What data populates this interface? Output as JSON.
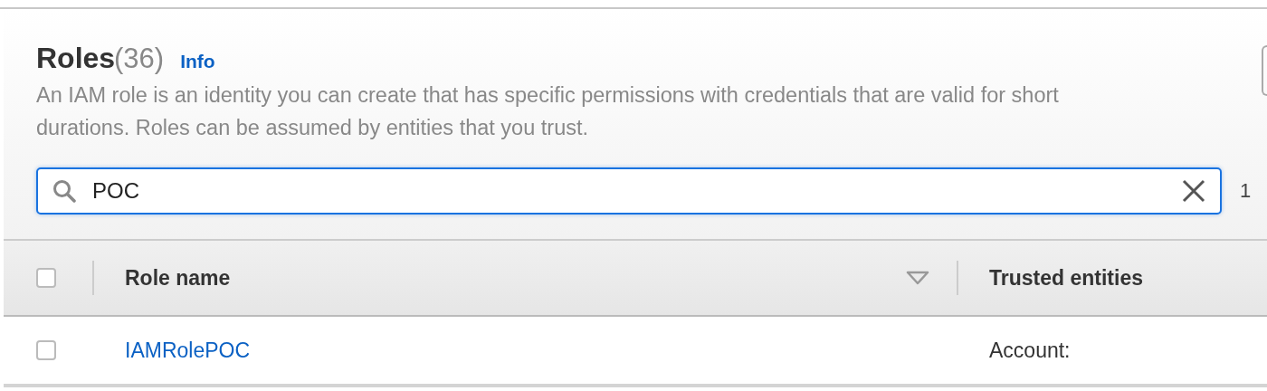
{
  "header": {
    "title": "Roles",
    "count": "(36)",
    "info_link": "Info",
    "description": "An IAM role is an identity you can create that has specific permissions with credentials that are valid for short durations. Roles can be assumed by entities that you trust."
  },
  "search": {
    "value": "POC",
    "results": "1"
  },
  "table": {
    "select_all": {
      "checked": false
    },
    "columns": [
      {
        "label": "Role name",
        "sortable": true
      },
      {
        "label": "Trusted entities",
        "sortable": false
      }
    ],
    "rows": [
      {
        "checked": false,
        "cells": [
          "IAMRolePOC",
          "Account:"
        ]
      }
    ]
  }
}
